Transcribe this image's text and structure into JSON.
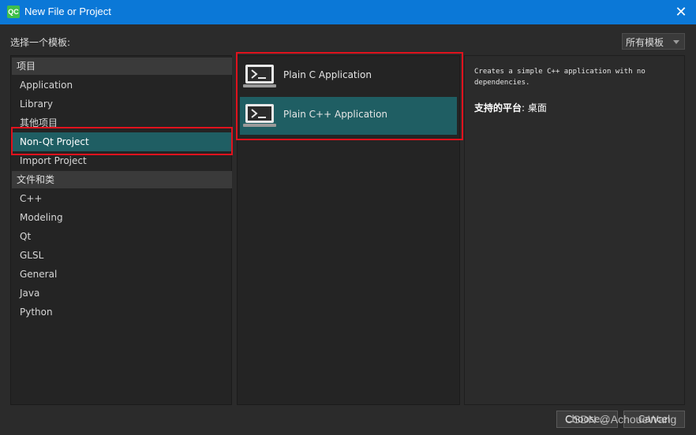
{
  "window": {
    "title": "New File or Project",
    "logo": "QC"
  },
  "header": {
    "choose_label": "选择一个模板:",
    "filter_value": "所有模板"
  },
  "categories": {
    "groups": [
      {
        "title": "项目",
        "items": [
          "Application",
          "Library",
          "其他项目",
          "Non-Qt Project",
          "Import Project"
        ]
      },
      {
        "title": "文件和类",
        "items": [
          "C++",
          "Modeling",
          "Qt",
          "GLSL",
          "General",
          "Java",
          "Python"
        ]
      }
    ],
    "selected": "Non-Qt Project"
  },
  "templates": {
    "items": [
      {
        "label": "Plain C Application",
        "icon": "terminal-icon"
      },
      {
        "label": "Plain C++ Application",
        "icon": "terminal-icon"
      }
    ],
    "selected": "Plain C++ Application"
  },
  "details": {
    "description": "Creates a simple C++ application with no dependencies.",
    "platforms_label": "支持的平台",
    "platforms_value": ": 桌面"
  },
  "buttons": {
    "choose": "Choose...",
    "cancel": "Cancel"
  },
  "watermark": "CSDN @AchoueWang",
  "colors": {
    "titlebar": "#0b78d7",
    "selection": "#1f5e63",
    "highlight_box": "#e0121d"
  }
}
